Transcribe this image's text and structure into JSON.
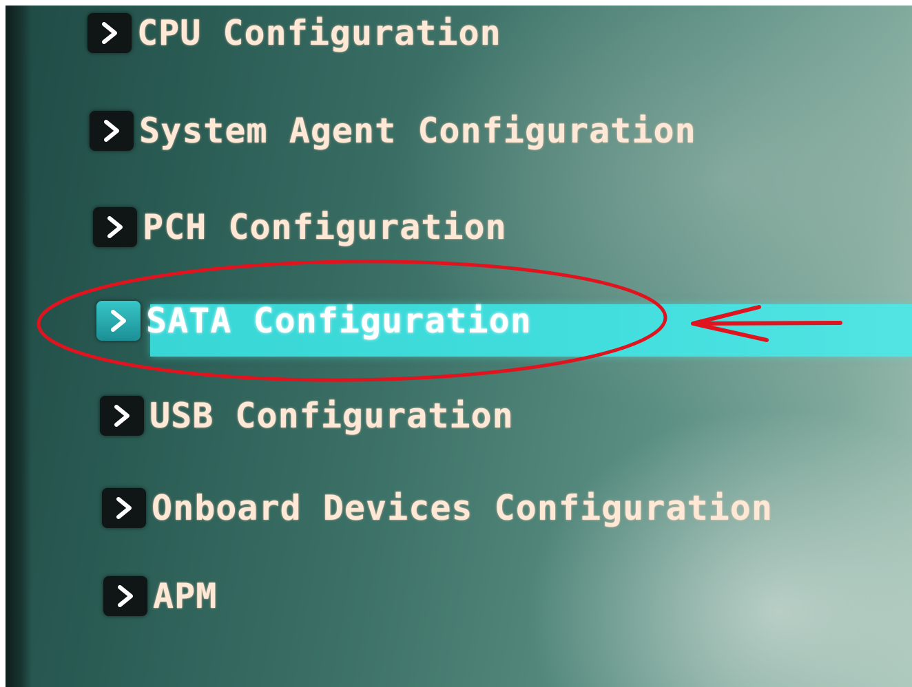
{
  "menu": {
    "items": [
      {
        "label": "CPU Configuration"
      },
      {
        "label": "System Agent Configuration"
      },
      {
        "label": "PCH Configuration"
      },
      {
        "label": "SATA Configuration",
        "selected": true
      },
      {
        "label": "USB Configuration"
      },
      {
        "label": "Onboard Devices Configuration"
      },
      {
        "label": "APM"
      }
    ],
    "submenu_icon": "chevron-right-icon"
  },
  "colors": {
    "selection_highlight": "#42dede",
    "label_text": "#ffe9d6",
    "annotation_red": "#e0141e"
  }
}
